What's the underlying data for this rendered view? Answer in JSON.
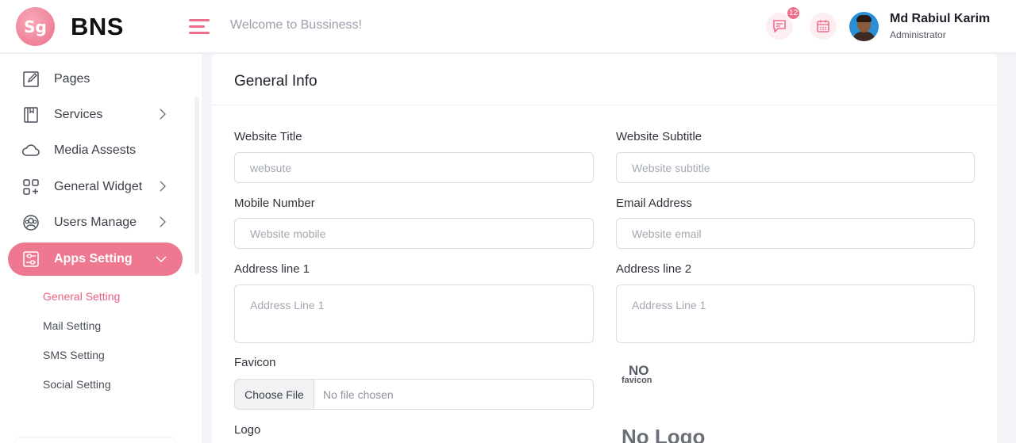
{
  "header": {
    "logo_text": "Sg",
    "brand": "BNS",
    "welcome": "Welcome to Bussiness!",
    "notification_count": "12",
    "user_name": "Md Rabiul Karim",
    "user_role": "Administrator"
  },
  "sidebar": {
    "items": [
      {
        "label": "Pages",
        "icon": "edit-icon"
      },
      {
        "label": "Services",
        "icon": "book-icon"
      },
      {
        "label": "Media Assests",
        "icon": "cloud-icon"
      },
      {
        "label": "General Widget",
        "icon": "widgets-icon"
      },
      {
        "label": "Users Manage",
        "icon": "users-icon"
      },
      {
        "label": "Apps Setting",
        "icon": "settings-sliders-icon"
      }
    ],
    "sub_items": [
      "General Setting",
      "Mail Setting",
      "SMS Setting",
      "Social Setting"
    ]
  },
  "form": {
    "title": "General Info",
    "website_title_label": "Website Title",
    "website_title_placeholder": "websute",
    "website_subtitle_label": "Website Subtitle",
    "website_subtitle_placeholder": "Website subtitle",
    "mobile_label": "Mobile Number",
    "mobile_placeholder": "Website mobile",
    "email_label": "Email Address",
    "email_placeholder": "Website email",
    "address1_label": "Address line 1",
    "address1_placeholder": "Address Line 1",
    "address2_label": "Address line 2",
    "address2_placeholder": "Address Line 1",
    "favicon_label": "Favicon",
    "choose_file": "Choose File",
    "no_file": "No file chosen",
    "no_favicon_a": "NO",
    "no_favicon_b": "favicon",
    "logo_label": "Logo",
    "no_logo": "No Logo"
  },
  "colors": {
    "accent": "#ee7890",
    "accent_text": "#e8627f"
  }
}
